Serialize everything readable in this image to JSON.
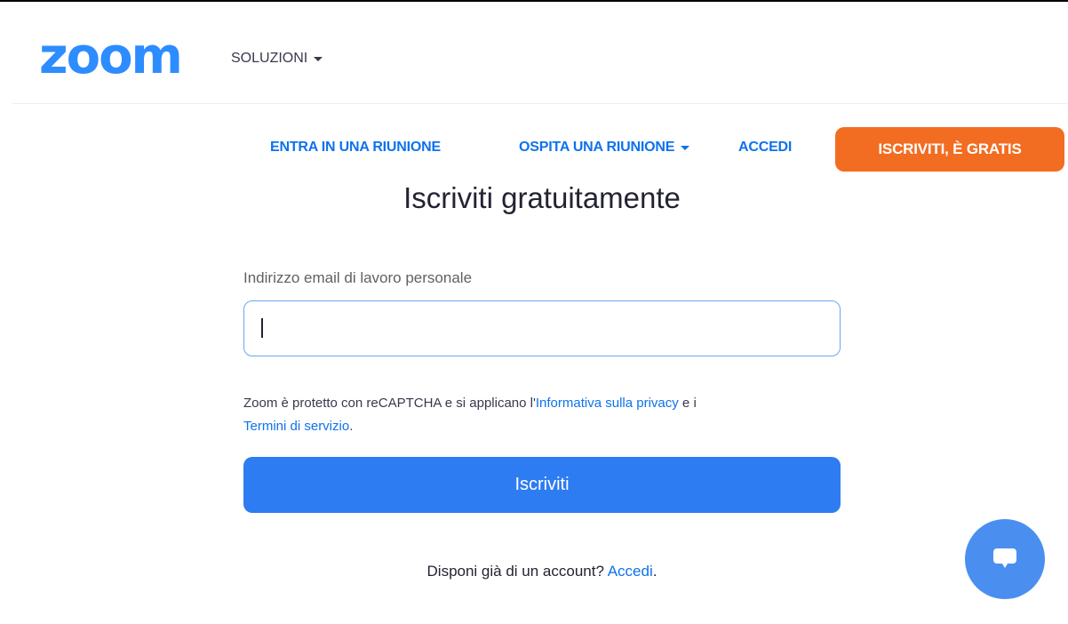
{
  "header": {
    "logo": "zoom",
    "solutions_label": "SOLUZIONI",
    "solutions_icon": "caret-down-icon"
  },
  "nav": {
    "join_meeting": "ENTRA IN UNA RIUNIONE",
    "host_meeting": "OSPITA UNA RIUNIONE",
    "host_meeting_icon": "caret-down-icon",
    "sign_in": "ACCEDI",
    "signup_free": "ISCRIVITI, È GRATIS"
  },
  "form": {
    "title": "Iscriviti gratuitamente",
    "email_label": "Indirizzo email di lavoro personale",
    "email_value": "",
    "legal_prefix": "Zoom è protetto con reCAPTCHA e si applicano l'",
    "privacy_link": "Informativa sulla privacy",
    "legal_middle": " e i ",
    "terms_link": "Termini di servizio",
    "legal_suffix": ".",
    "submit_label": "Iscriviti",
    "account_prompt": "Disponi già di un account? ",
    "account_link": "Accedi",
    "account_suffix": "."
  },
  "chat": {
    "icon": "chat-bubble-icon"
  },
  "colors": {
    "brand_blue": "#2d8cff",
    "link_blue": "#0e72ed",
    "primary_button": "#2d7cf2",
    "signup_orange": "#f26d21",
    "chat_button": "#4a8ff0"
  }
}
